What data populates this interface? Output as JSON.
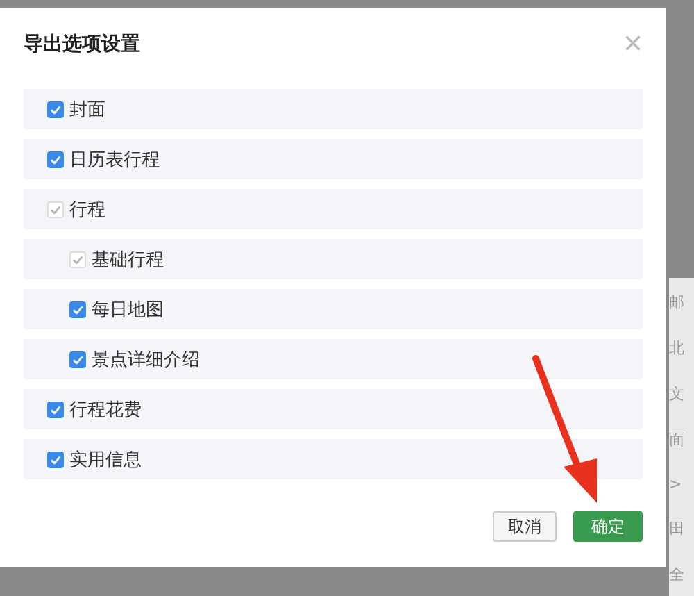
{
  "dialog": {
    "title": "导出选项设置",
    "close": "×",
    "options": [
      {
        "label": "封面",
        "checked": true,
        "disabled": false
      },
      {
        "label": "日历表行程",
        "checked": true,
        "disabled": false
      },
      {
        "label": "行程",
        "checked": true,
        "disabled": true,
        "children": [
          {
            "label": "基础行程",
            "checked": true,
            "disabled": true
          },
          {
            "label": "每日地图",
            "checked": true,
            "disabled": false
          },
          {
            "label": "景点详细介绍",
            "checked": true,
            "disabled": false
          }
        ]
      },
      {
        "label": "行程花费",
        "checked": true,
        "disabled": false
      },
      {
        "label": "实用信息",
        "checked": true,
        "disabled": false
      }
    ],
    "buttons": [
      {
        "label": "取消",
        "kind": "secondary"
      },
      {
        "label": "确定",
        "kind": "primary"
      }
    ]
  },
  "background_text": [
    "邮",
    "北",
    "文",
    "面",
    ">",
    "田",
    "全"
  ]
}
